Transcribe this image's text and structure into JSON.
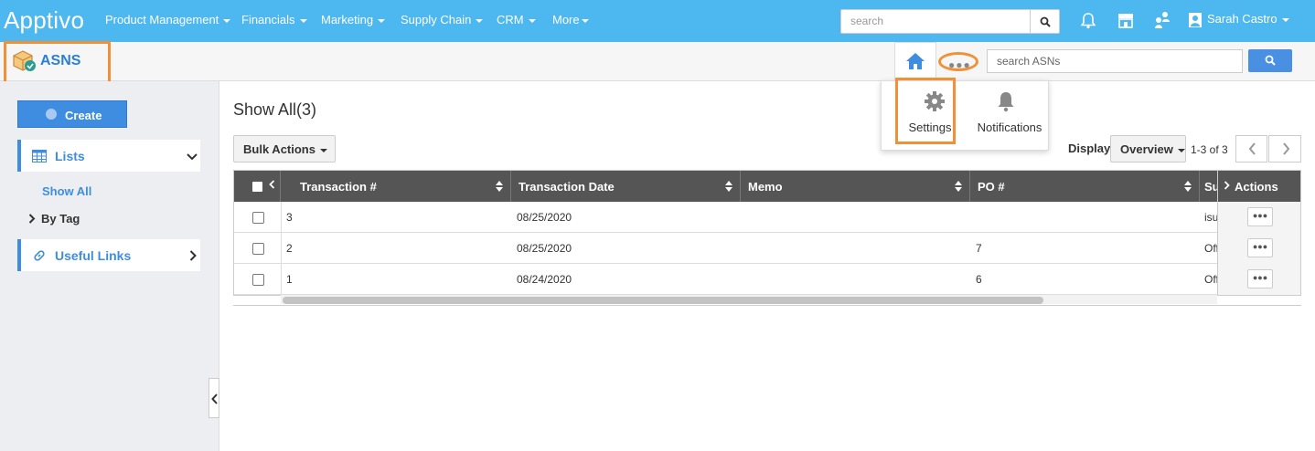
{
  "topnav": {
    "logo": "Apptivo",
    "menu": [
      "Product Management",
      "Financials",
      "Marketing",
      "Supply Chain",
      "CRM",
      "More"
    ],
    "search_placeholder": "search",
    "user_name": "Sarah Castro",
    "background_color": "#4db7ef"
  },
  "appbar": {
    "title": "ASNS",
    "search_placeholder": "search ASNs"
  },
  "dropdown": {
    "settings_label": "Settings",
    "notifications_label": "Notifications"
  },
  "sidebar": {
    "create_label": "Create",
    "lists_label": "Lists",
    "show_all_label": "Show All",
    "by_tag_label": "By Tag",
    "useful_links_label": "Useful Links"
  },
  "main": {
    "title": "Show All(3)",
    "bulk_actions_label": "Bulk Actions",
    "display_label": "Display",
    "display_value": "Overview",
    "page_count": "1-3 of 3"
  },
  "table": {
    "columns": [
      "Transaction #",
      "Transaction Date",
      "Memo",
      "PO #",
      "Su",
      "Actions"
    ],
    "rows": [
      {
        "transaction": "3",
        "date": "08/25/2020",
        "memo": "",
        "po": "",
        "supplier": "isu"
      },
      {
        "transaction": "2",
        "date": "08/25/2020",
        "memo": "",
        "po": "7",
        "supplier": "Off"
      },
      {
        "transaction": "1",
        "date": "08/24/2020",
        "memo": "",
        "po": "6",
        "supplier": "Off"
      }
    ]
  },
  "highlight_color": "#f0913a",
  "accent_color": "#3f8de0"
}
